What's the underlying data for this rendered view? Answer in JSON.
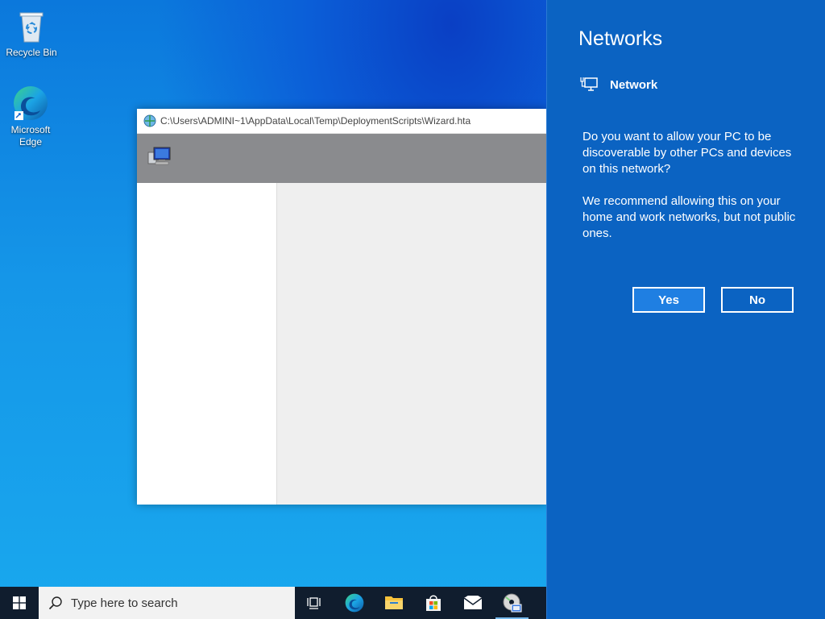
{
  "desktop": {
    "icons": [
      {
        "label": "Recycle Bin",
        "icon": "recycle-bin-icon"
      },
      {
        "label": "Microsoft Edge",
        "icon": "edge-icon"
      }
    ]
  },
  "wizard": {
    "title": "C:\\Users\\ADMINI~1\\AppData\\Local\\Temp\\DeploymentScripts\\Wizard.hta",
    "header_icon": "computer-icon",
    "colors": {
      "header": "#8a8b8e",
      "left_pane": "#ffffff",
      "right_pane": "#efefef"
    }
  },
  "network_flyout": {
    "title": "Networks",
    "network_name": "Network",
    "question": "Do you want to allow your PC to be discoverable by other PCs and devices on this network?",
    "recommendation": "We recommend allowing this on your home and work networks, but not public ones.",
    "yes_label": "Yes",
    "no_label": "No",
    "colors": {
      "background": "#0b63c2",
      "yes_button": "#1f7fe2"
    }
  },
  "taskbar": {
    "search_placeholder": "Type here to search",
    "items": [
      {
        "name": "task-view",
        "icon": "task-view-icon"
      },
      {
        "name": "edge",
        "icon": "edge-icon"
      },
      {
        "name": "file-explorer",
        "icon": "folder-icon"
      },
      {
        "name": "microsoft-store",
        "icon": "store-icon"
      },
      {
        "name": "mail",
        "icon": "mail-icon"
      },
      {
        "name": "wizard-app",
        "icon": "cd-setup-icon",
        "active": true
      }
    ]
  }
}
